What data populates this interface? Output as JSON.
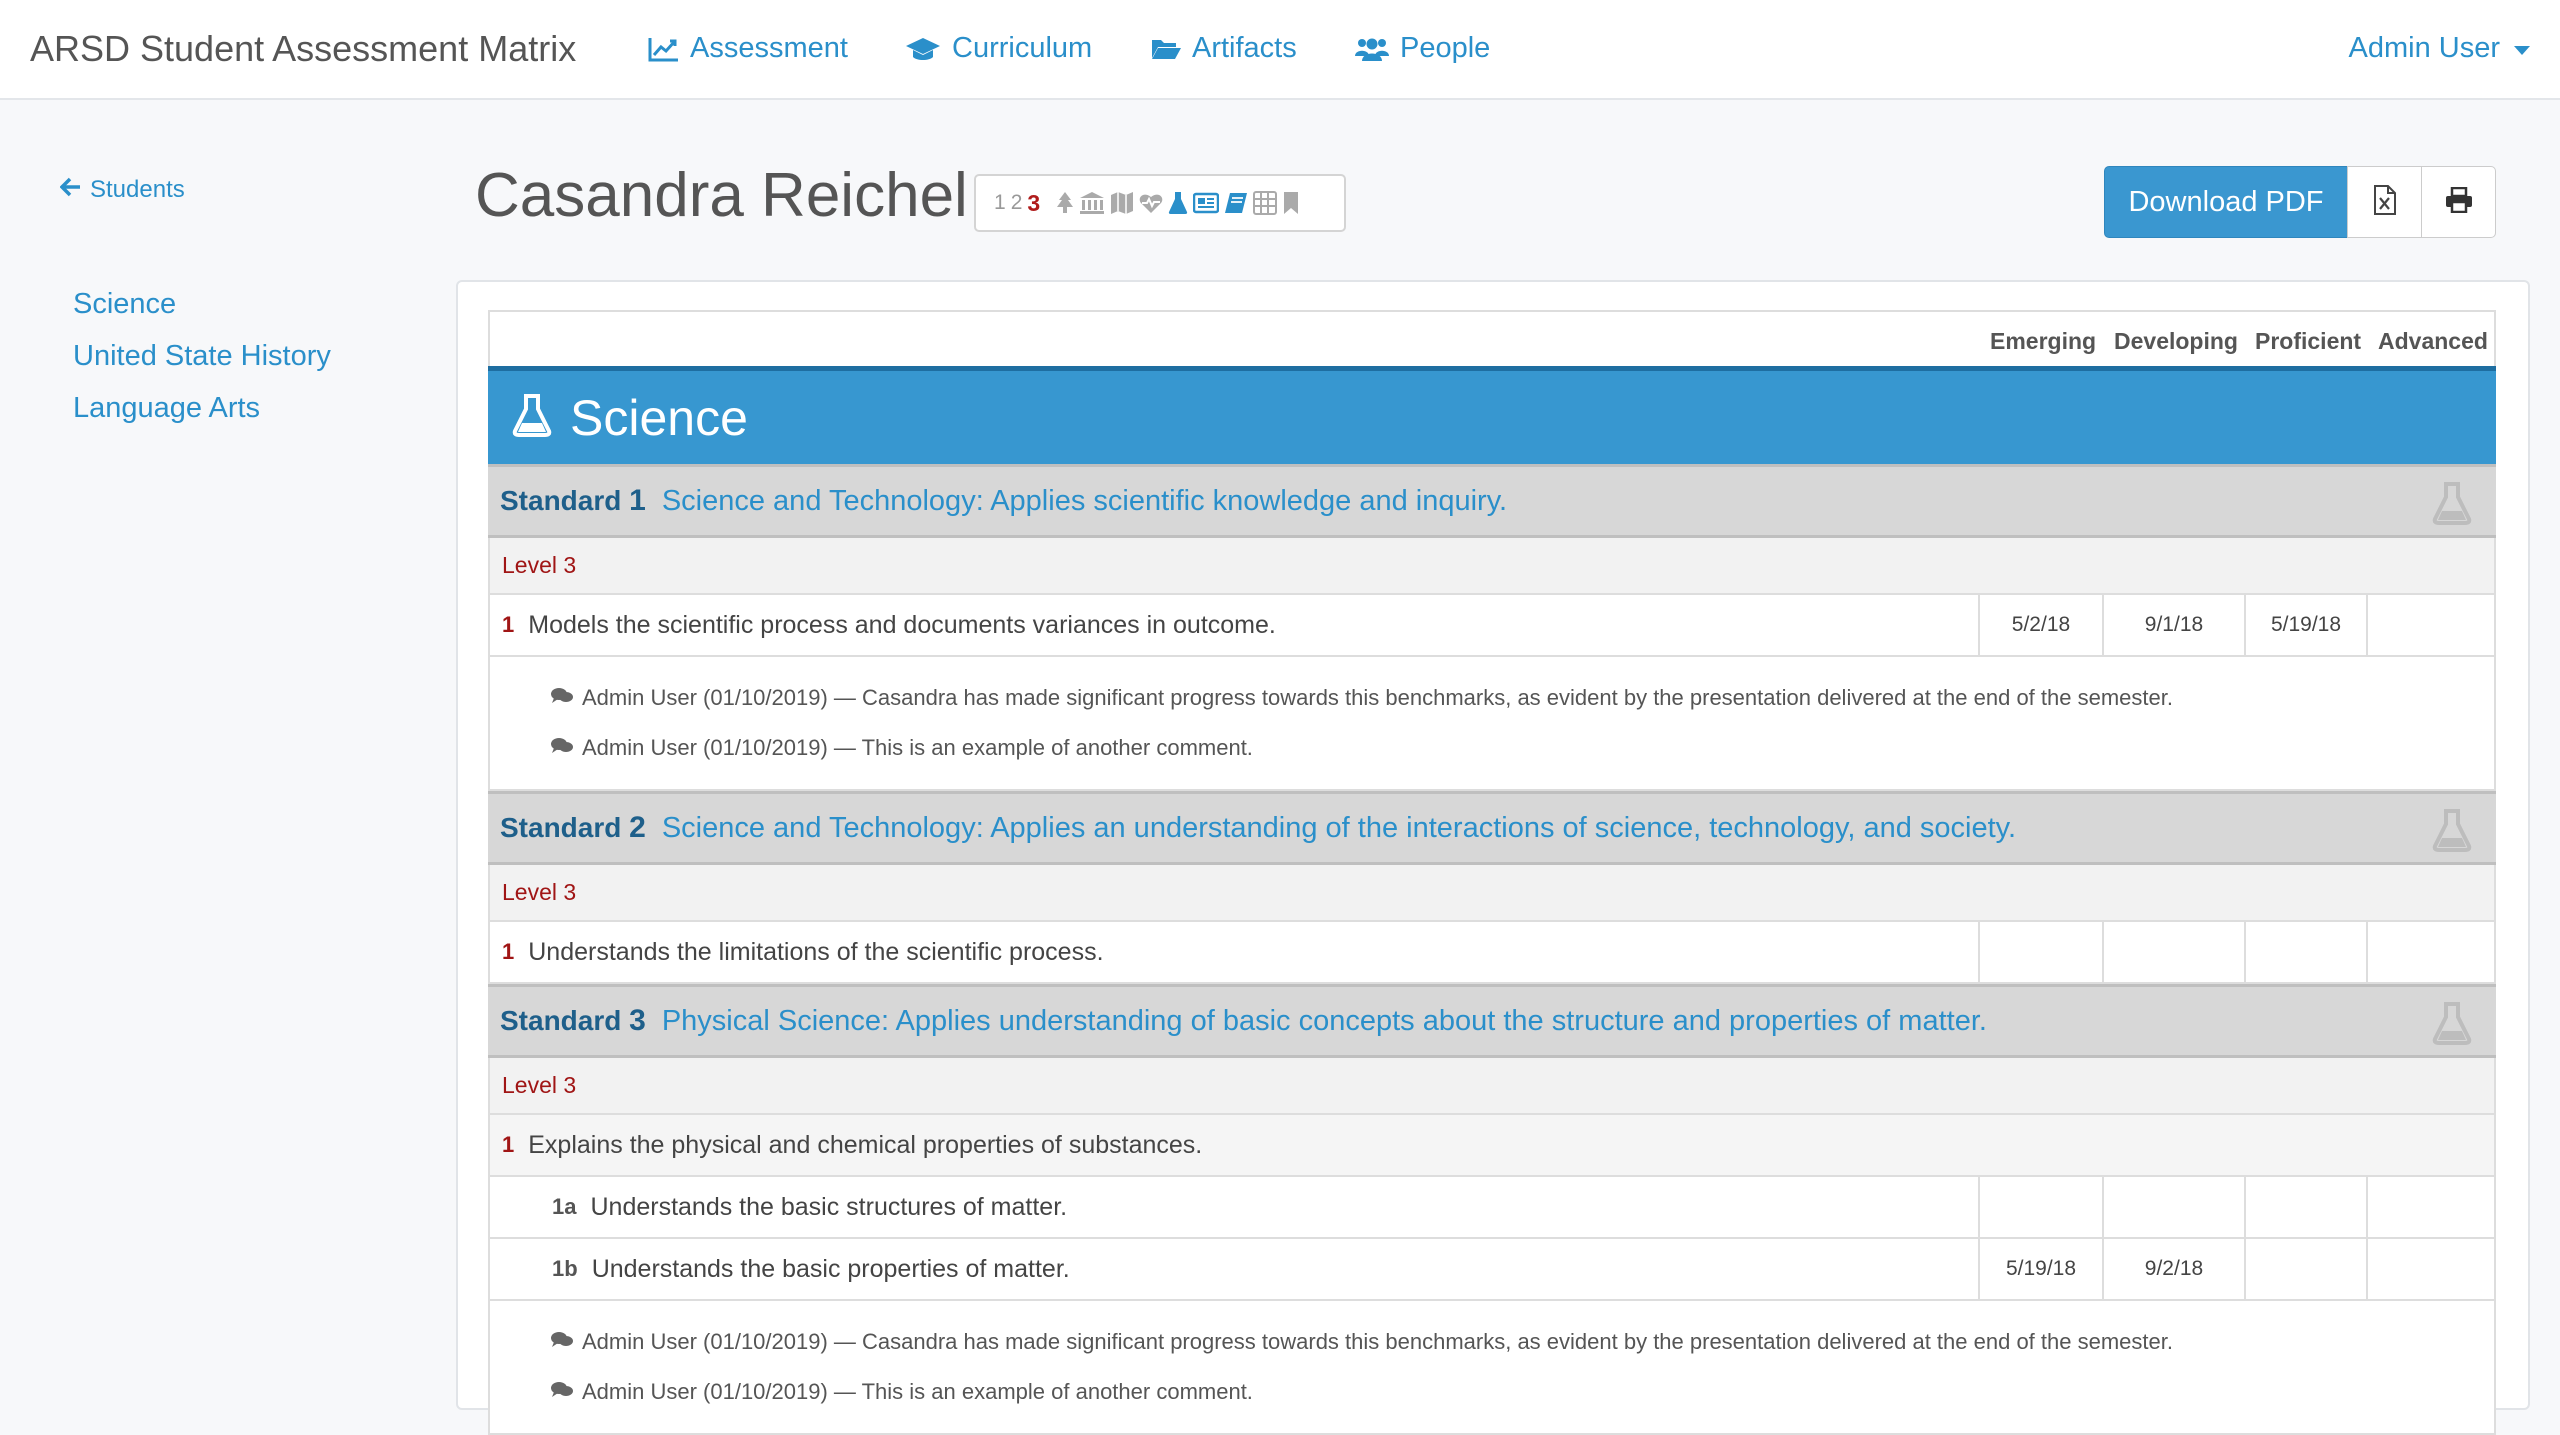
{
  "app": {
    "brand": "ARSD Student Assessment Matrix"
  },
  "nav": {
    "items": [
      {
        "label": "Assessment",
        "icon": "chart-line-icon"
      },
      {
        "label": "Curriculum",
        "icon": "graduation-cap-icon"
      },
      {
        "label": "Artifacts",
        "icon": "folder-open-icon"
      },
      {
        "label": "People",
        "icon": "users-icon"
      }
    ],
    "user": "Admin User"
  },
  "sidebar": {
    "back": "Students",
    "items": [
      {
        "label": "Science"
      },
      {
        "label": "United State History"
      },
      {
        "label": "Language Arts"
      }
    ]
  },
  "student": {
    "name": "Casandra Reichel",
    "levels": [
      "1",
      "2",
      "3"
    ],
    "active_level": "3"
  },
  "actions": {
    "download_pdf": "Download PDF"
  },
  "columns": [
    "Emerging",
    "Developing",
    "Proficient",
    "Advanced"
  ],
  "subject": {
    "title": "Science"
  },
  "standards": [
    {
      "label": "Standard",
      "num": "1",
      "title": "Science and Technology: Applies scientific knowledge and inquiry.",
      "level": "Level 3",
      "benchmarks": [
        {
          "num": "1",
          "text": "Models the scientific process and documents variances in outcome.",
          "dates": [
            "5/2/18",
            "9/1/18",
            "5/19/18",
            ""
          ]
        }
      ],
      "comments": [
        "Admin User (01/10/2019) — Casandra has made significant progress towards this benchmarks, as evident by the presentation delivered at the end of the semester.",
        "Admin User (01/10/2019) — This is an example of another comment."
      ]
    },
    {
      "label": "Standard",
      "num": "2",
      "title": "Science and Technology: Applies an understanding of the interactions of science, technology, and society.",
      "level": "Level 3",
      "benchmarks": [
        {
          "num": "1",
          "text": "Understands the limitations of the scientific process.",
          "dates": [
            "",
            "",
            "",
            ""
          ]
        }
      ]
    },
    {
      "label": "Standard",
      "num": "3",
      "title": "Physical Science: Applies understanding of basic concepts about the structure and properties of matter.",
      "level": "Level 3",
      "benchmarks": [
        {
          "num": "1",
          "text": "Explains the physical and chemical properties of substances."
        },
        {
          "num": "1a",
          "text": "Understands the basic structures of matter.",
          "dates": [
            "",
            "",
            "",
            ""
          ]
        },
        {
          "num": "1b",
          "text": "Understands the basic properties of matter.",
          "dates": [
            "5/19/18",
            "9/2/18",
            "",
            ""
          ]
        }
      ],
      "comments": [
        "Admin User (01/10/2019) — Casandra has made significant progress towards this benchmarks, as evident by the presentation delivered at the end of the semester.",
        "Admin User (01/10/2019) — This is an example of another comment."
      ]
    }
  ],
  "colors": {
    "accent": "#2a8fca",
    "subject_bar": "#3797d0",
    "level_red": "#a01515"
  }
}
